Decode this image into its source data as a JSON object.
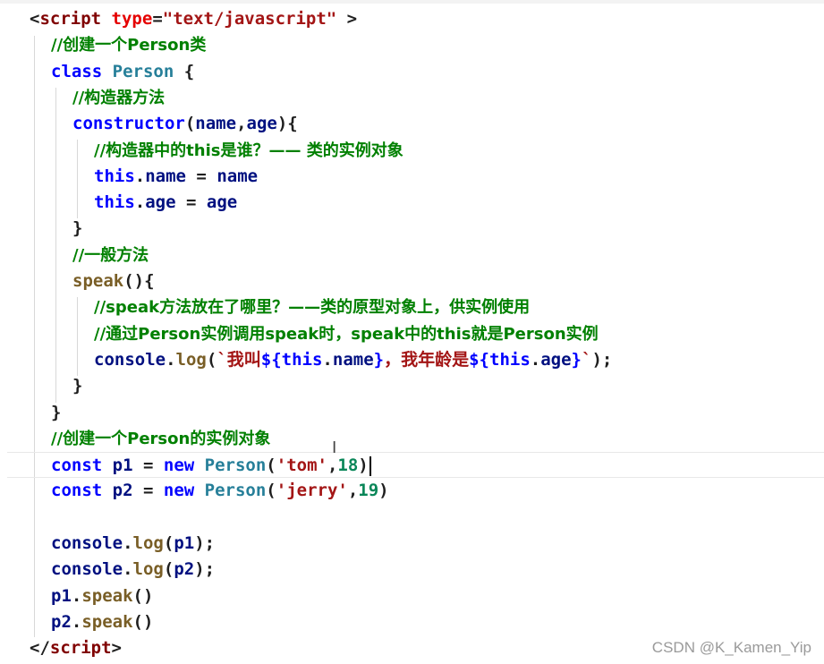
{
  "editor": {
    "lines": [
      {
        "tokens": [
          [
            "t-pun",
            "<"
          ],
          [
            "t-tag",
            "script"
          ],
          [
            "t-pun",
            " "
          ],
          [
            "t-attr",
            "type"
          ],
          [
            "t-pun",
            "="
          ],
          [
            "t-str",
            "\"text/javascript\""
          ],
          [
            "t-pun",
            " >"
          ]
        ]
      },
      {
        "tokens": [
          [
            "t-com",
            "//创建一个Person类"
          ]
        ]
      },
      {
        "tokens": [
          [
            "t-kw",
            "class"
          ],
          [
            "t-pun",
            " "
          ],
          [
            "t-cls",
            "Person"
          ],
          [
            "t-pun",
            " {"
          ]
        ]
      },
      {
        "tokens": [
          [
            "t-com",
            "//构造器方法"
          ]
        ]
      },
      {
        "tokens": [
          [
            "t-kw",
            "constructor"
          ],
          [
            "t-pun",
            "("
          ],
          [
            "t-var",
            "name"
          ],
          [
            "t-pun",
            ","
          ],
          [
            "t-var",
            "age"
          ],
          [
            "t-pun",
            "){"
          ]
        ]
      },
      {
        "tokens": [
          [
            "t-com",
            "//构造器中的this是谁？—— 类的实例对象"
          ]
        ]
      },
      {
        "tokens": [
          [
            "t-kw",
            "this"
          ],
          [
            "t-pun",
            "."
          ],
          [
            "t-var",
            "name"
          ],
          [
            "t-pun",
            " = "
          ],
          [
            "t-var",
            "name"
          ]
        ]
      },
      {
        "tokens": [
          [
            "t-kw",
            "this"
          ],
          [
            "t-pun",
            "."
          ],
          [
            "t-var",
            "age"
          ],
          [
            "t-pun",
            " = "
          ],
          [
            "t-var",
            "age"
          ]
        ]
      },
      {
        "tokens": [
          [
            "t-pun",
            "}"
          ]
        ]
      },
      {
        "tokens": [
          [
            "t-com",
            "//一般方法"
          ]
        ]
      },
      {
        "tokens": [
          [
            "t-fn",
            "speak"
          ],
          [
            "t-pun",
            "(){"
          ]
        ]
      },
      {
        "tokens": [
          [
            "t-com",
            "//speak方法放在了哪里？——类的原型对象上，供实例使用"
          ]
        ]
      },
      {
        "tokens": [
          [
            "t-com",
            "//通过Person实例调用speak时，speak中的this就是Person实例"
          ]
        ]
      },
      {
        "tokens": [
          [
            "t-var",
            "console"
          ],
          [
            "t-pun",
            "."
          ],
          [
            "t-fn",
            "log"
          ],
          [
            "t-pun",
            "("
          ],
          [
            "t-tpl",
            "`我叫"
          ],
          [
            "t-kw",
            "${"
          ],
          [
            "t-kw",
            "this"
          ],
          [
            "t-pun",
            "."
          ],
          [
            "t-var",
            "name"
          ],
          [
            "t-kw",
            "}"
          ],
          [
            "t-tpl",
            "，我年龄是"
          ],
          [
            "t-kw",
            "${"
          ],
          [
            "t-kw",
            "this"
          ],
          [
            "t-pun",
            "."
          ],
          [
            "t-var",
            "age"
          ],
          [
            "t-kw",
            "}"
          ],
          [
            "t-tpl",
            "`"
          ],
          [
            "t-pun",
            ");"
          ]
        ]
      },
      {
        "tokens": [
          [
            "t-pun",
            "}"
          ]
        ]
      },
      {
        "tokens": [
          [
            "t-pun",
            "}"
          ]
        ]
      },
      {
        "tokens": [
          [
            "t-com",
            "//创建一个Person的实例对象"
          ]
        ]
      },
      {
        "tokens": [
          [
            "t-kw",
            "const"
          ],
          [
            "t-pun",
            " "
          ],
          [
            "t-var",
            "p1"
          ],
          [
            "t-pun",
            " = "
          ],
          [
            "t-kw",
            "new"
          ],
          [
            "t-pun",
            " "
          ],
          [
            "t-cls",
            "Person"
          ],
          [
            "t-pun",
            "("
          ],
          [
            "t-str",
            "'tom'"
          ],
          [
            "t-pun",
            ","
          ],
          [
            "t-num",
            "18"
          ],
          [
            "t-pun",
            ")"
          ]
        ]
      },
      {
        "tokens": [
          [
            "t-kw",
            "const"
          ],
          [
            "t-pun",
            " "
          ],
          [
            "t-var",
            "p2"
          ],
          [
            "t-pun",
            " = "
          ],
          [
            "t-kw",
            "new"
          ],
          [
            "t-pun",
            " "
          ],
          [
            "t-cls",
            "Person"
          ],
          [
            "t-pun",
            "("
          ],
          [
            "t-str",
            "'jerry'"
          ],
          [
            "t-pun",
            ","
          ],
          [
            "t-num",
            "19"
          ],
          [
            "t-pun",
            ")"
          ]
        ]
      },
      {
        "tokens": []
      },
      {
        "tokens": [
          [
            "t-var",
            "console"
          ],
          [
            "t-pun",
            "."
          ],
          [
            "t-fn",
            "log"
          ],
          [
            "t-pun",
            "("
          ],
          [
            "t-var",
            "p1"
          ],
          [
            "t-pun",
            ");"
          ]
        ]
      },
      {
        "tokens": [
          [
            "t-var",
            "console"
          ],
          [
            "t-pun",
            "."
          ],
          [
            "t-fn",
            "log"
          ],
          [
            "t-pun",
            "("
          ],
          [
            "t-var",
            "p2"
          ],
          [
            "t-pun",
            ");"
          ]
        ]
      },
      {
        "tokens": [
          [
            "t-var",
            "p1"
          ],
          [
            "t-pun",
            "."
          ],
          [
            "t-fn",
            "speak"
          ],
          [
            "t-pun",
            "()"
          ]
        ]
      },
      {
        "tokens": [
          [
            "t-var",
            "p2"
          ],
          [
            "t-pun",
            "."
          ],
          [
            "t-fn",
            "speak"
          ],
          [
            "t-pun",
            "()"
          ]
        ]
      },
      {
        "tokens": [
          [
            "t-pun",
            "</"
          ],
          [
            "t-tag",
            "script"
          ],
          [
            "t-pun",
            ">"
          ]
        ]
      }
    ],
    "cursor_line": 17
  },
  "watermark": "CSDN @K_Kamen_Yip"
}
